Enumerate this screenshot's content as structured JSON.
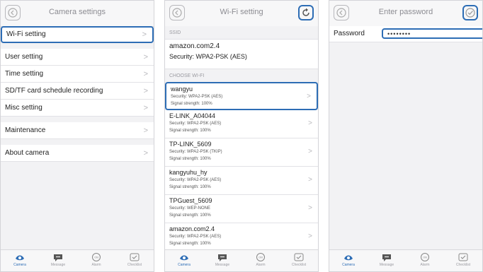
{
  "screen1": {
    "title": "Camera settings",
    "menu": [
      {
        "label": "Wi-Fi setting",
        "chevron": ">"
      },
      {
        "label": "User setting",
        "chevron": ">"
      },
      {
        "label": "Time setting",
        "chevron": ">"
      },
      {
        "label": "SD/TF card schedule recording",
        "chevron": ">"
      },
      {
        "label": "Misc setting",
        "chevron": ">"
      },
      {
        "label": "Maintenance",
        "chevron": ">"
      },
      {
        "label": "About camera",
        "chevron": ">"
      }
    ]
  },
  "screen2": {
    "title": "Wi-Fi setting",
    "ssid_header": "SSID",
    "ssid_name": "amazon.com2.4",
    "ssid_security": "Security: WPA2-PSK (AES)",
    "choose_header": "CHOOSE WI-FI",
    "networks": [
      {
        "name": "wangyu",
        "security": "Security: WPA2-PSK (AES)",
        "signal": "Signal strength: 100%",
        "chevron": ">"
      },
      {
        "name": "E-LINK_A04044",
        "security": "Security: WPA2-PSK (AES)",
        "signal": "Signal strength: 100%",
        "chevron": ">"
      },
      {
        "name": "TP-LINK_5609",
        "security": "Security: WPA2-PSK (TKIP)",
        "signal": "Signal strength: 100%",
        "chevron": ">"
      },
      {
        "name": "kangyuhu_hy",
        "security": "Security: WPA2-PSK (AES)",
        "signal": "Signal strength: 100%",
        "chevron": ">"
      },
      {
        "name": "TPGuest_5609",
        "security": "Security: WEP-NONE",
        "signal": "Signal strength: 100%",
        "chevron": ">"
      },
      {
        "name": "amazon.com2.4",
        "security": "Security: WPA2-PSK (AES)",
        "signal": "Signal strength: 100%",
        "chevron": ">"
      }
    ]
  },
  "screen3": {
    "title": "Enter password",
    "password_label": "Password",
    "password_value": "••••••••"
  },
  "tabbar": {
    "tabs": [
      {
        "label": "Camera",
        "icon": "camera-eye-icon"
      },
      {
        "label": "Message",
        "icon": "message-bubble-icon"
      },
      {
        "label": "Alarm",
        "icon": "alarm-icon"
      },
      {
        "label": "Checklist",
        "icon": "checklist-icon"
      }
    ]
  },
  "colors": {
    "highlight": "#2d6db5",
    "background": "#f2f2f4",
    "chevron": "#b8b8bc"
  }
}
